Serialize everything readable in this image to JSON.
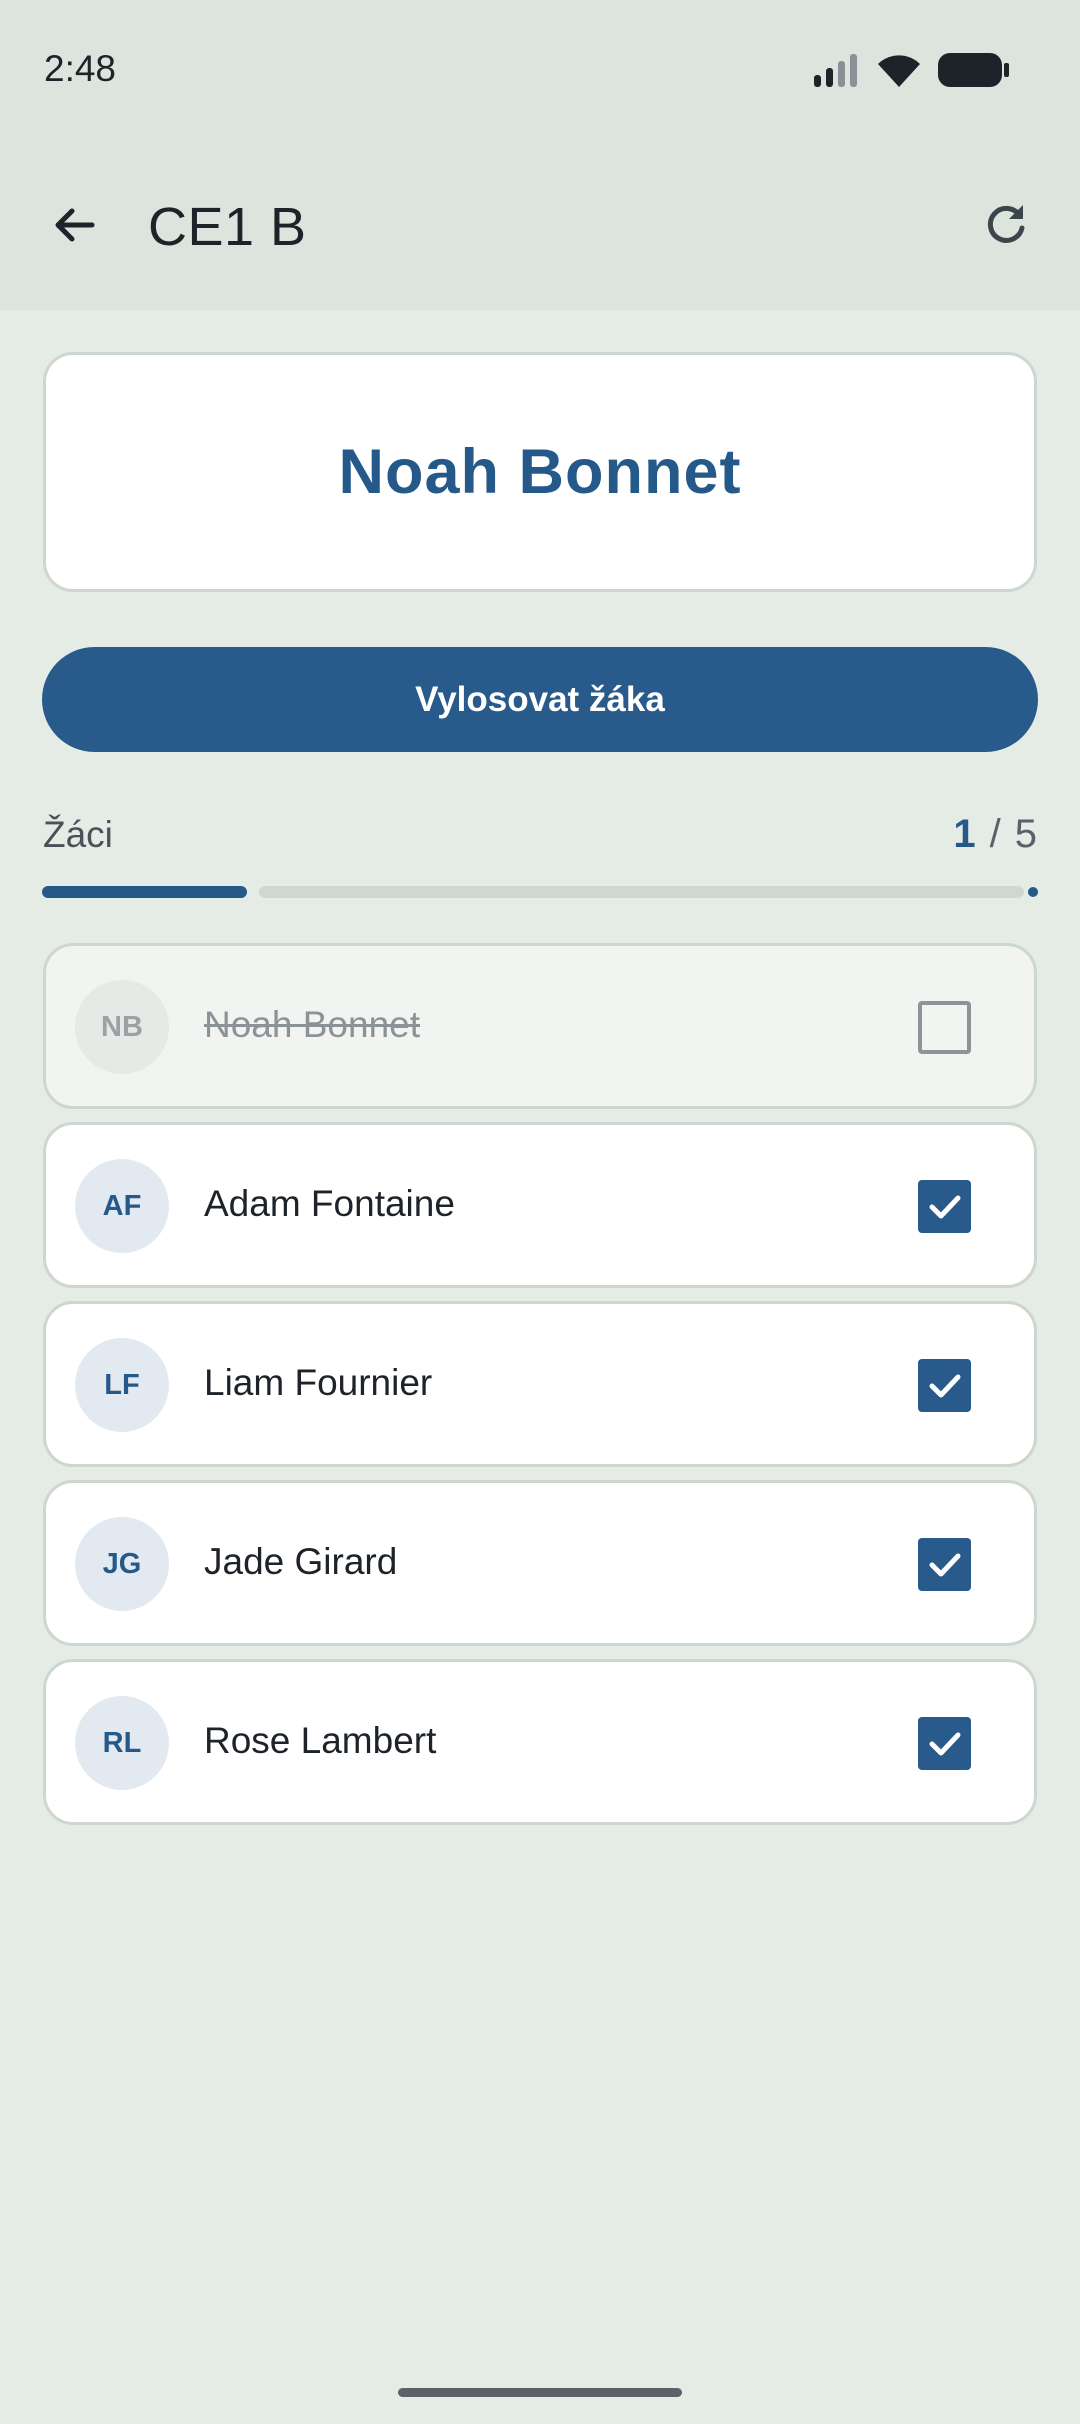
{
  "status_bar": {
    "time": "2:48",
    "icons": [
      "signal-icon",
      "wifi-icon",
      "battery-icon"
    ]
  },
  "app_bar": {
    "title": "CE1 B",
    "back_icon": "arrow-back-icon",
    "refresh_icon": "refresh-icon"
  },
  "result": {
    "name": "Noah Bonnet"
  },
  "draw_button": {
    "label": "Vylosovat žáka"
  },
  "list": {
    "label": "Žáci",
    "count_current": "1",
    "count_separator": "/",
    "count_total": "5",
    "progress_fraction": 0.2
  },
  "students": [
    {
      "initials": "NB",
      "name": "Noah Bonnet",
      "drawn": true,
      "checked": false
    },
    {
      "initials": "AF",
      "name": "Adam Fontaine",
      "drawn": false,
      "checked": true
    },
    {
      "initials": "LF",
      "name": "Liam Fournier",
      "drawn": false,
      "checked": true
    },
    {
      "initials": "JG",
      "name": "Jade Girard",
      "drawn": false,
      "checked": true
    },
    {
      "initials": "RL",
      "name": "Rose Lambert",
      "drawn": false,
      "checked": true
    }
  ],
  "colors": {
    "accent": "#285b8b",
    "background": "#e5ece6",
    "app_bar": "#dce4de"
  }
}
